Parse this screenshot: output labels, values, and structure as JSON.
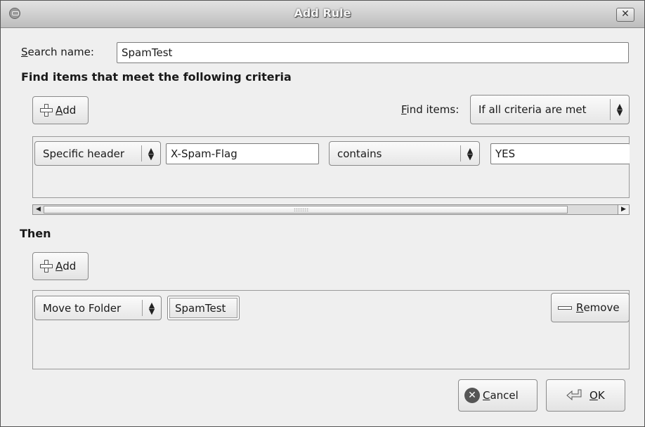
{
  "window": {
    "title": "Add Rule",
    "close_glyph": "✕"
  },
  "search": {
    "label_mnemonic": "S",
    "label_rest": "earch name:",
    "value": "SpamTest"
  },
  "criteria": {
    "heading": "Find items that meet the following criteria",
    "add_mnemonic": "A",
    "add_rest": "dd",
    "find_label_mnemonic": "F",
    "find_label_rest": "ind items:",
    "find_selected": "If all criteria are met",
    "rule": {
      "field": "Specific header",
      "header_name": "X-Spam-Flag",
      "operator": "contains",
      "value": "YES"
    }
  },
  "then": {
    "heading": "Then",
    "add_mnemonic": "A",
    "add_rest": "dd",
    "action": {
      "type": "Move to Folder",
      "folder": "SpamTest",
      "remove_mnemonic": "R",
      "remove_rest": "emove"
    }
  },
  "footer": {
    "cancel_mnemonic": "C",
    "cancel_rest": "ancel",
    "ok_mnemonic": "O",
    "ok_rest": "K"
  },
  "icons": {
    "window_menu": "window-menu-icon",
    "close": "close-icon",
    "add": "plus-icon",
    "remove": "minus-icon",
    "cancel": "cancel-circle-icon",
    "ok": "enter-arrow-icon",
    "combo_arrows": "up-down-arrows-icon"
  }
}
